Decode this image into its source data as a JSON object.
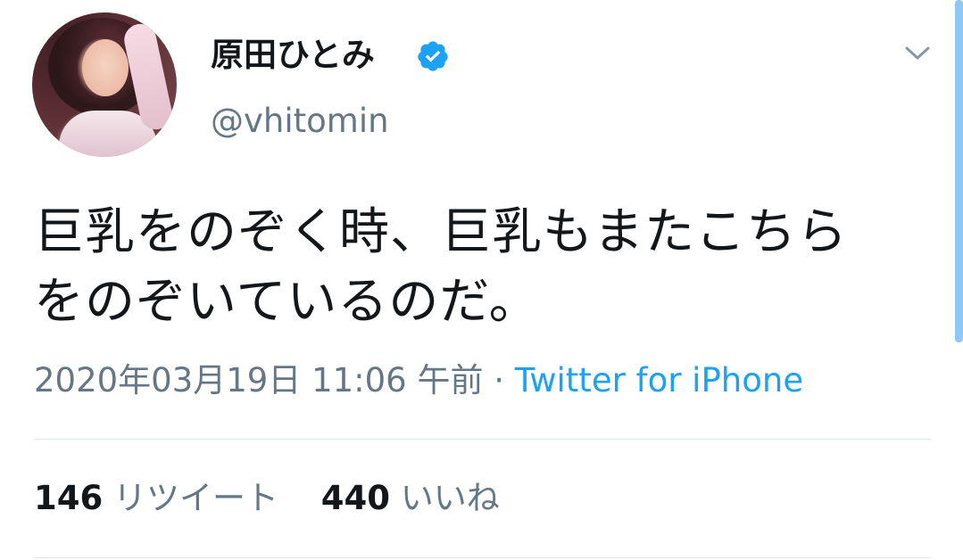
{
  "user": {
    "display_name": "原田ひとみ",
    "handle": "@vhitomin",
    "verified_icon": "verified-badge-icon",
    "avatar_alt": "profile photo"
  },
  "tweet": {
    "line1": "巨乳をのぞく時、巨乳もまたこちら",
    "line2": "をのぞいているのだ。"
  },
  "meta": {
    "date": "2020年03月19日 11:06 午前",
    "separator": "·",
    "source": "Twitter for iPhone"
  },
  "stats": {
    "retweets_count": "146",
    "retweets_label": "リツイート",
    "likes_count": "440",
    "likes_label": "いいね"
  },
  "colors": {
    "link": "#1da1f2",
    "secondary_text": "#657786",
    "divider": "#e1e8ed"
  }
}
